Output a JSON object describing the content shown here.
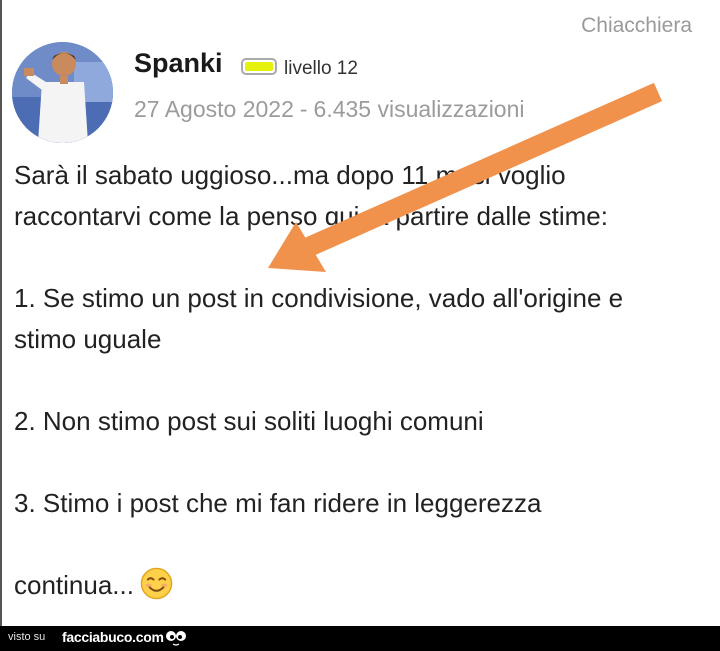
{
  "post": {
    "category": "Chiacchiera",
    "author": {
      "name": "Spanki",
      "level_label": "livello 12",
      "badge_color": "#e6f20c"
    },
    "date": "27 Agosto 2022",
    "separator": "-",
    "views": "6.435 visualizzazioni",
    "body": {
      "line1": "Sarà il sabato uggioso...ma dopo 11 mesi voglio",
      "line2": "raccontarvi come la penso qui, a partire dalle stime:",
      "item1a": "1. Se stimo un post in condivisione, vado all'origine e",
      "item1b": "stimo uguale",
      "item2": "2. Non stimo post sui soliti luoghi comuni",
      "item3": "3. Stimo i post che mi fan ridere in leggerezza",
      "continue": "continua..."
    },
    "emoji_icon": "smiling-face-icon",
    "arrow_color": "#f0914c"
  },
  "footer": {
    "visto_su": "visto su",
    "brand": "facciabuco.com"
  }
}
